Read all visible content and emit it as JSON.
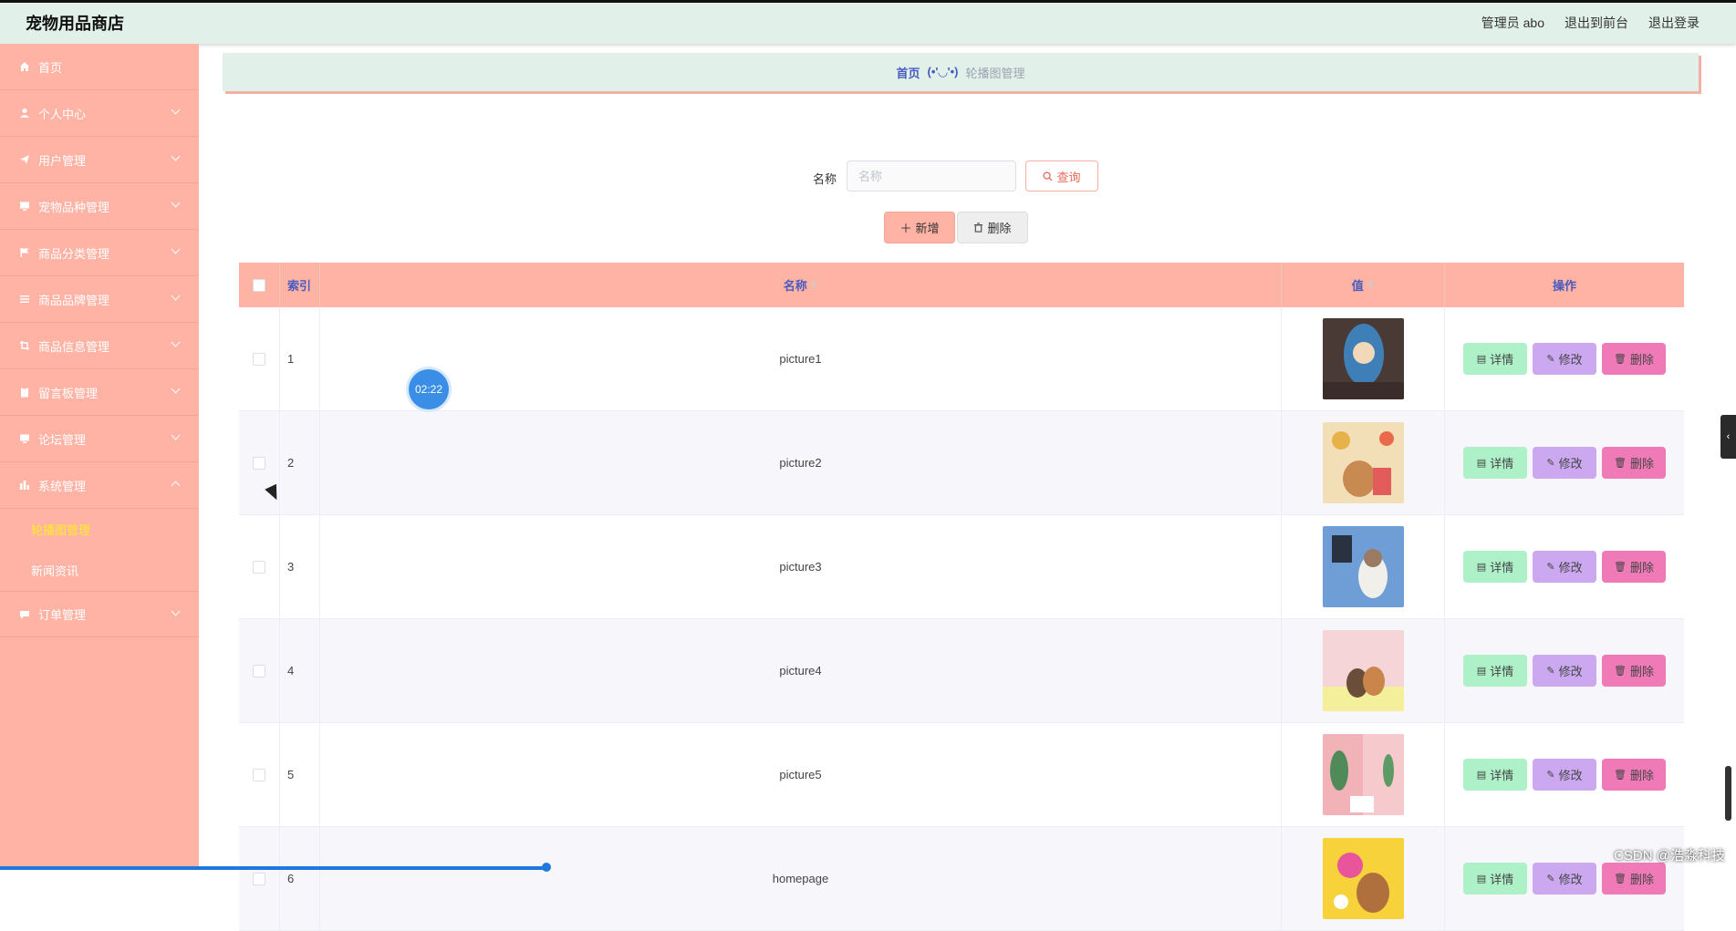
{
  "header": {
    "brand": "宠物用品商店",
    "admin": "管理员 abo",
    "back_to_front": "退出到前台",
    "logout": "退出登录"
  },
  "sidebar": {
    "items": [
      {
        "label": "首页",
        "icon": "home-icon"
      },
      {
        "label": "个人中心",
        "icon": "user-icon"
      },
      {
        "label": "用户管理",
        "icon": "send-icon"
      },
      {
        "label": "宠物品种管理",
        "icon": "monitor-icon"
      },
      {
        "label": "商品分类管理",
        "icon": "flag-icon"
      },
      {
        "label": "商品品牌管理",
        "icon": "list-icon"
      },
      {
        "label": "商品信息管理",
        "icon": "crop-icon"
      },
      {
        "label": "留言板管理",
        "icon": "clipboard-icon"
      },
      {
        "label": "论坛管理",
        "icon": "monitor-icon"
      },
      {
        "label": "系统管理",
        "icon": "chart-icon"
      },
      {
        "label": "订单管理",
        "icon": "chat-icon"
      }
    ],
    "system_sub": [
      {
        "label": "轮播图管理",
        "active": true
      },
      {
        "label": "新闻资讯",
        "active": false
      }
    ]
  },
  "breadcrumb": {
    "home": "首页",
    "face": "(•'◡'•)",
    "current": "轮播图管理"
  },
  "search": {
    "label": "名称",
    "placeholder": "名称",
    "button": "查询"
  },
  "actions": {
    "add": "新增",
    "delete": "删除"
  },
  "table": {
    "headers": {
      "index": "索引",
      "name": "名称",
      "value": "值",
      "ops": "操作"
    },
    "op_labels": {
      "detail": "详情",
      "edit": "修改",
      "delete": "删除"
    },
    "rows": [
      {
        "index": "1",
        "name": "picture1"
      },
      {
        "index": "2",
        "name": "picture2"
      },
      {
        "index": "3",
        "name": "picture3"
      },
      {
        "index": "4",
        "name": "picture4"
      },
      {
        "index": "5",
        "name": "picture5"
      },
      {
        "index": "6",
        "name": "homepage"
      }
    ]
  },
  "overlay": {
    "timer": "02:22",
    "watermark": "CSDN @浩淼科技"
  },
  "colors": {
    "sidebar": "#ffb3a5",
    "header": "#e2f0ea",
    "accent": "#4a5bbf",
    "detail": "#aef0c8",
    "edit": "#cba8ef",
    "delete": "#f07ab8"
  }
}
